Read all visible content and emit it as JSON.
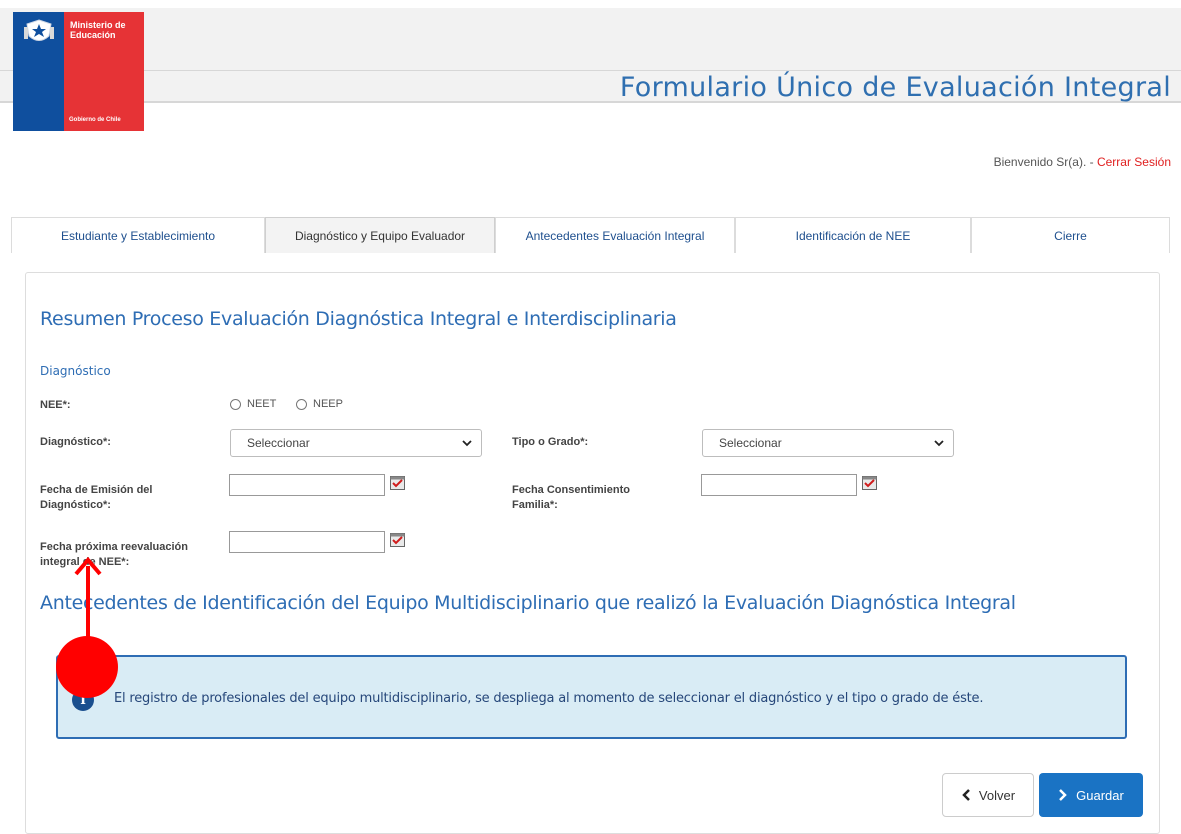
{
  "header": {
    "logo_ministry": "Ministerio de Educación",
    "logo_government": "Gobierno de Chile",
    "app_title": "Formulario Único de Evaluación Integral",
    "welcome_text": "Bienvenido Sr(a). - ",
    "logout_link": "Cerrar Sesión"
  },
  "tabs": [
    {
      "label": "Estudiante y Establecimiento",
      "active": false
    },
    {
      "label": "Diagnóstico y Equipo Evaluador",
      "active": true
    },
    {
      "label": "Antecedentes Evaluación Integral",
      "active": false
    },
    {
      "label": "Identificación de NEE",
      "active": false
    },
    {
      "label": "Cierre",
      "active": false
    }
  ],
  "form": {
    "summary_heading": "Resumen Proceso Evaluación Diagnóstica Integral e Interdisciplinaria",
    "diagnosis_subheading": "Diagnóstico",
    "nee_label": "NEE*:",
    "nee_options": [
      "NEET",
      "NEEP"
    ],
    "diagnostico_label": "Diagnóstico*:",
    "diagnostico_value": "Seleccionar",
    "tipo_label": "Tipo o Grado*:",
    "tipo_value": "Seleccionar",
    "fecha_emision_label": "Fecha de Emisión del Diagnóstico*:",
    "fecha_consentimiento_label": "Fecha Consentimiento Familia*:",
    "fecha_reevaluacion_label": "Fecha próxima reevaluación integral de NEE*:",
    "fecha_emision_value": "",
    "fecha_consentimiento_value": "",
    "fecha_reevaluacion_value": ""
  },
  "team": {
    "heading": "Antecedentes de Identificación del Equipo Multidisciplinario que realizó la Evaluación Diagnóstica Integral",
    "info_icon": "i",
    "info_text": "El registro de profesionales del equipo multidisciplinario, se despliega al momento de seleccionar el diagnóstico y el tipo o grado de éste."
  },
  "buttons": {
    "back_label": "Volver",
    "save_label": "Guardar"
  },
  "colors": {
    "accent": "#2e6db4",
    "primary_button": "#1a73c4",
    "logo_blue": "#0f4f9e",
    "logo_red": "#e63336",
    "annotation": "#ff0000"
  }
}
